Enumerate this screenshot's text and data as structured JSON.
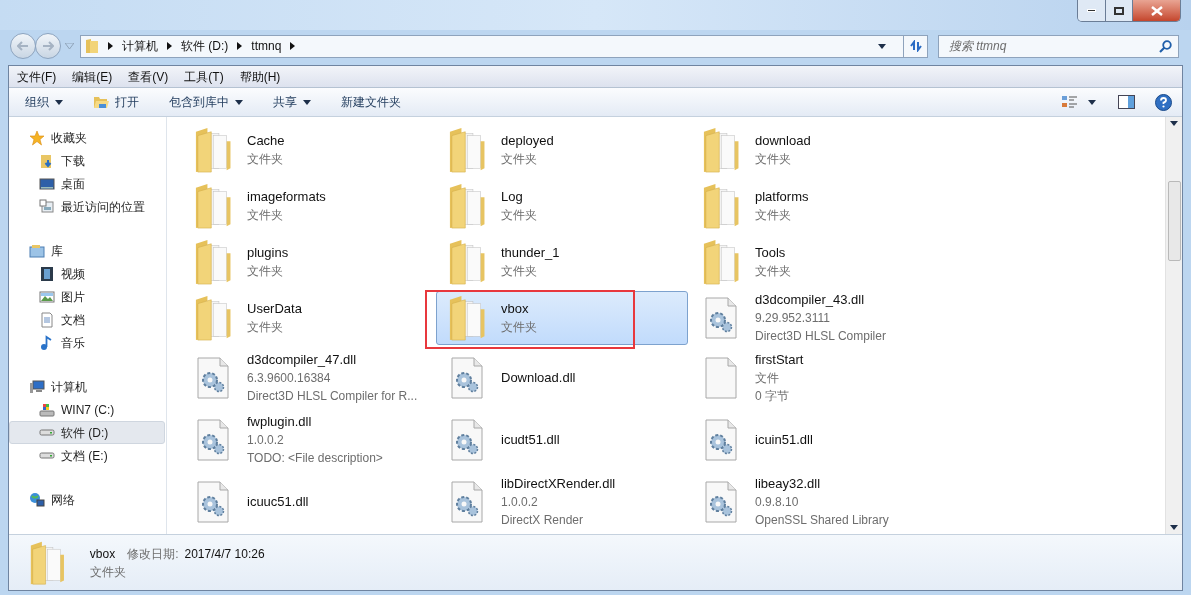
{
  "address": {
    "crumbs": [
      "计算机",
      "软件 (D:)",
      "ttmnq"
    ]
  },
  "search": {
    "placeholder": "搜索 ttmnq"
  },
  "menu": [
    "文件(F)",
    "编辑(E)",
    "查看(V)",
    "工具(T)",
    "帮助(H)"
  ],
  "toolbar": [
    {
      "label": "组织",
      "kind": "menu"
    },
    {
      "label": "打开",
      "kind": "open"
    },
    {
      "label": "包含到库中",
      "kind": "menu"
    },
    {
      "label": "共享",
      "kind": "menu"
    },
    {
      "label": "新建文件夹",
      "kind": "plain"
    }
  ],
  "sidebar": [
    {
      "label": "收藏夹",
      "kind": "favorites",
      "selected": false,
      "children": [
        {
          "label": "下载",
          "kind": "downloads",
          "selected": false
        },
        {
          "label": "桌面",
          "kind": "desktop",
          "selected": false
        },
        {
          "label": "最近访问的位置",
          "kind": "recent",
          "selected": false
        }
      ]
    },
    {
      "label": "库",
      "kind": "library",
      "selected": false,
      "children": [
        {
          "label": "视频",
          "kind": "videos",
          "selected": false
        },
        {
          "label": "图片",
          "kind": "pictures",
          "selected": false
        },
        {
          "label": "文档",
          "kind": "documents",
          "selected": false
        },
        {
          "label": "音乐",
          "kind": "music",
          "selected": false
        }
      ]
    },
    {
      "label": "计算机",
      "kind": "computer",
      "selected": false,
      "children": [
        {
          "label": "WIN7 (C:)",
          "kind": "system",
          "selected": false
        },
        {
          "label": "软件 (D:)",
          "kind": "drive",
          "selected": true
        },
        {
          "label": "文档 (E:)",
          "kind": "drive",
          "selected": false
        }
      ]
    },
    {
      "label": "网络",
      "kind": "network",
      "selected": false
    }
  ],
  "files": [
    {
      "name": "Cache",
      "kind": "folder",
      "details": [
        "文件夹"
      ],
      "selected": false,
      "annotated": false
    },
    {
      "name": "deployed",
      "kind": "folder",
      "details": [
        "文件夹"
      ],
      "selected": false,
      "annotated": false
    },
    {
      "name": "download",
      "kind": "folder",
      "details": [
        "文件夹"
      ],
      "selected": false,
      "annotated": false
    },
    {
      "name": "imageformats",
      "kind": "folder",
      "details": [
        "文件夹"
      ],
      "selected": false,
      "annotated": false
    },
    {
      "name": "Log",
      "kind": "folder",
      "details": [
        "文件夹"
      ],
      "selected": false,
      "annotated": false
    },
    {
      "name": "platforms",
      "kind": "folder",
      "details": [
        "文件夹"
      ],
      "selected": false,
      "annotated": false
    },
    {
      "name": "plugins",
      "kind": "folder",
      "details": [
        "文件夹"
      ],
      "selected": false,
      "annotated": false
    },
    {
      "name": "thunder_1",
      "kind": "folder",
      "details": [
        "文件夹"
      ],
      "selected": false,
      "annotated": false
    },
    {
      "name": "Tools",
      "kind": "folder",
      "details": [
        "文件夹"
      ],
      "selected": false,
      "annotated": false
    },
    {
      "name": "UserData",
      "kind": "folder",
      "details": [
        "文件夹"
      ],
      "selected": false,
      "annotated": false
    },
    {
      "name": "vbox",
      "kind": "folder",
      "details": [
        "文件夹"
      ],
      "selected": true,
      "annotated": true
    },
    {
      "name": "d3dcompiler_43.dll",
      "kind": "dll",
      "details": [
        "9.29.952.3111",
        "Direct3D HLSL Compiler"
      ],
      "selected": false,
      "annotated": false
    },
    {
      "name": "d3dcompiler_47.dll",
      "kind": "dll",
      "details": [
        "6.3.9600.16384",
        "Direct3D HLSL Compiler for R..."
      ],
      "selected": false,
      "annotated": false
    },
    {
      "name": "Download.dll",
      "kind": "dll",
      "selected": false,
      "annotated": false
    },
    {
      "name": "firstStart",
      "kind": "file",
      "details": [
        "文件",
        "0 字节"
      ],
      "selected": false,
      "annotated": false
    },
    {
      "name": "fwplugin.dll",
      "kind": "dll",
      "details": [
        "1.0.0.2",
        "TODO: <File description>"
      ],
      "selected": false,
      "annotated": false
    },
    {
      "name": "icudt51.dll",
      "kind": "dll",
      "selected": false,
      "annotated": false
    },
    {
      "name": "icuin51.dll",
      "kind": "dll",
      "selected": false,
      "annotated": false
    },
    {
      "name": "icuuc51.dll",
      "kind": "dll",
      "selected": false,
      "annotated": false
    },
    {
      "name": "libDirectXRender.dll",
      "kind": "dll",
      "details": [
        "1.0.0.2",
        "DirectX Render"
      ],
      "selected": false,
      "annotated": false
    },
    {
      "name": "libeay32.dll",
      "kind": "dll",
      "details": [
        "0.9.8.10",
        "OpenSSL Shared Library"
      ],
      "selected": false,
      "annotated": false
    }
  ],
  "status": {
    "name": "vbox",
    "modified_label": "修改日期:",
    "modified": "2017/4/7 10:26",
    "type": "文件夹"
  }
}
